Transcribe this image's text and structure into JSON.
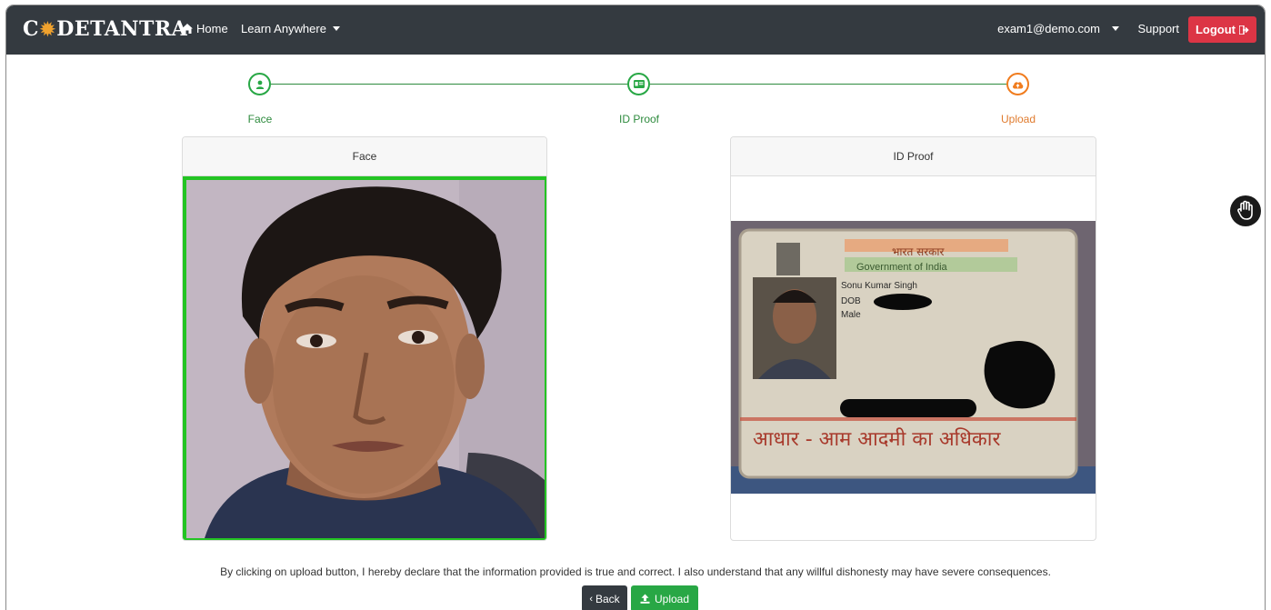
{
  "navbar": {
    "brand": "C⚙DETANTRA",
    "brand_parts": [
      "C",
      "DETANTRA"
    ],
    "home_label": "Home",
    "learn_label": "Learn Anywhere",
    "user_email": "exam1@demo.com",
    "support_label": "Support",
    "logout_label": "Logout"
  },
  "stepper": {
    "steps": [
      {
        "label": "Face",
        "icon": "user-icon",
        "state": "done"
      },
      {
        "label": "ID Proof",
        "icon": "id-card-icon",
        "state": "done"
      },
      {
        "label": "Upload",
        "icon": "cloud-upload-icon",
        "state": "active"
      }
    ],
    "colors": {
      "done": "#28a745",
      "active": "#f07c1e"
    }
  },
  "cards": {
    "face_title": "Face",
    "id_title": "ID Proof"
  },
  "id_card": {
    "line1": "भारत सरकार",
    "line2": "Government of India",
    "name": "Sonu Kumar Singh",
    "dob": "DOB",
    "gender": "Male",
    "footer": "आधार - आम आदमी का अधिकार"
  },
  "footer": {
    "declaration": "By clicking on upload button, I hereby declare that the information provided is true and correct. I also understand that any willful dishonesty may have severe consequences.",
    "back_label": "Back",
    "upload_label": "Upload"
  },
  "colors": {
    "navbar": "#343a40",
    "logout": "#dc3545",
    "upload": "#28a745",
    "face_border": "#23c423"
  }
}
